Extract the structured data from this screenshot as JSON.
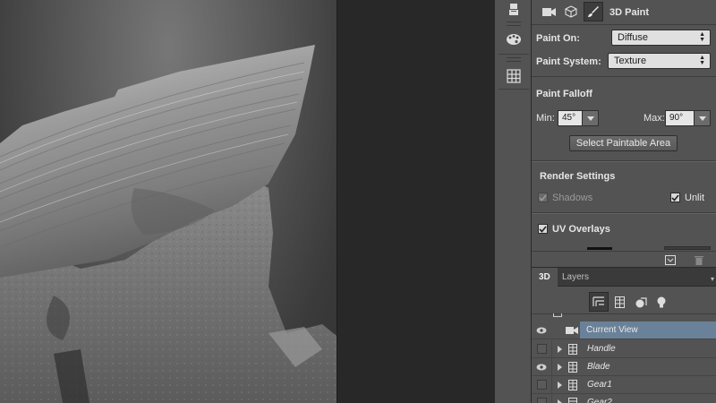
{
  "properties": {
    "title": "3D Paint",
    "paint_on_label": "Paint On:",
    "paint_on_value": "Diffuse",
    "paint_system_label": "Paint System:",
    "paint_system_value": "Texture",
    "falloff_heading": "Paint Falloff",
    "min_label": "Min:",
    "min_value": "45°",
    "max_label": "Max:",
    "max_value": "90°",
    "select_paintable_label": "Select Paintable Area",
    "render_settings_heading": "Render Settings",
    "shadows_label": "Shadows",
    "unlit_label": "Unlit",
    "uv_overlays_label": "UV Overlays",
    "shadows_checked": true,
    "unlit_checked": true,
    "uv_overlays_checked": true
  },
  "tabs": {
    "tab_3d": "3D",
    "tab_layers": "Layers"
  },
  "scene": {
    "rows": [
      {
        "name": "Current View",
        "visible": true,
        "selected": true
      },
      {
        "name": "Handle",
        "visible": false,
        "selected": false
      },
      {
        "name": "Blade",
        "visible": true,
        "selected": false
      },
      {
        "name": "Gear1",
        "visible": false,
        "selected": false
      },
      {
        "name": "Gear2",
        "visible": false,
        "selected": false
      }
    ]
  },
  "icons": {
    "properties_tabs": [
      "video-camera-icon",
      "mesh-cube-icon",
      "paint-brush-icon"
    ],
    "toolstrip": [
      "brush-tool-icon",
      "palette-icon",
      "grid-icon"
    ],
    "scene_filters": [
      "scene-filter-icon",
      "mesh-filter-icon",
      "material-filter-icon",
      "light-bulb-icon"
    ]
  },
  "colors": {
    "panel_bg": "#535353",
    "selection": "#6a8299",
    "dark_bg": "#282828"
  }
}
